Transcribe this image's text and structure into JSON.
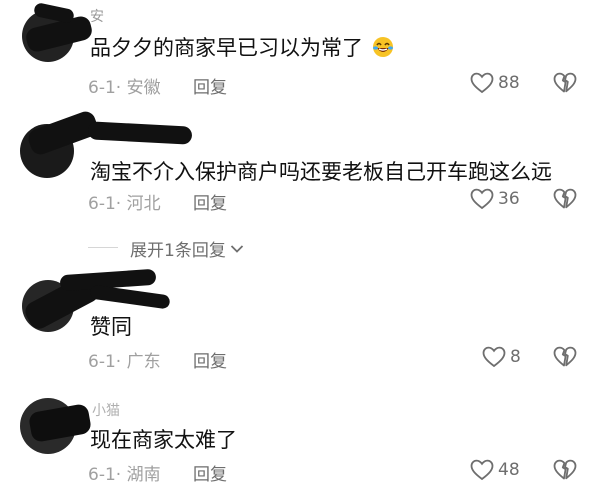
{
  "comments": [
    {
      "username": "安",
      "text": "品夕夕的商家早已习以为常了",
      "emoji": "rolling-laughing-emoji",
      "date": "6-1",
      "location": "安徽",
      "reply_label": "回复",
      "likes": "88"
    },
    {
      "username": "",
      "text": "淘宝不介入保护商户吗还要老板自己开车跑这么远",
      "date": "6-1",
      "location": "河北",
      "reply_label": "回复",
      "likes": "36",
      "expand_label": "展开1条回复"
    },
    {
      "username": "",
      "text": "赞同",
      "date": "6-1",
      "location": "广东",
      "reply_label": "回复",
      "likes": "8"
    },
    {
      "username": "小猫",
      "text": "现在商家太难了",
      "date": "6-1",
      "location": "湖南",
      "reply_label": "回复",
      "likes": "48"
    }
  ],
  "colors": {
    "meta_text": "#a0a0a0",
    "action_text": "#6e6e6e",
    "body_text": "#111111"
  }
}
